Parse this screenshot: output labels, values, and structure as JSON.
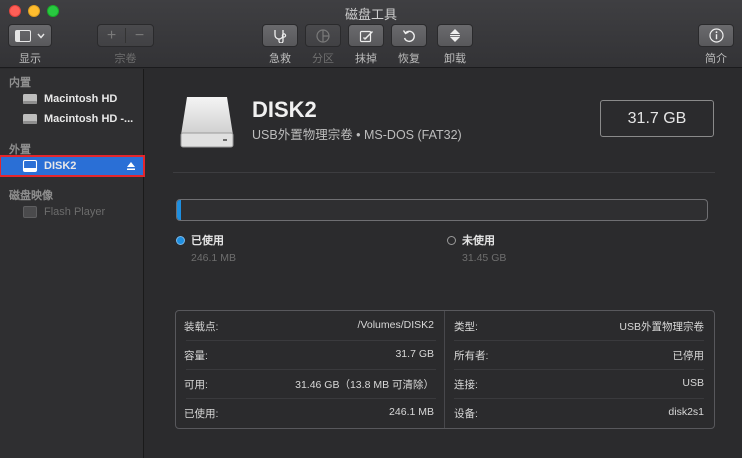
{
  "window": {
    "title": "磁盘工具"
  },
  "toolbar": {
    "view_label": "显示",
    "volume_label": "宗卷",
    "first_aid_label": "急救",
    "partition_label": "分区",
    "erase_label": "抹掉",
    "restore_label": "恢复",
    "unmount_label": "卸载",
    "info_label": "简介"
  },
  "sidebar": {
    "internal_header": "内置",
    "internal_items": [
      "Macintosh HD",
      "Macintosh HD -..."
    ],
    "external_header": "外置",
    "external_items": [
      "DISK2"
    ],
    "images_header": "磁盘映像",
    "image_items": [
      "Flash Player"
    ]
  },
  "disk": {
    "name": "DISK2",
    "subtitle": "USB外置物理宗卷 • MS-DOS (FAT32)",
    "capacity": "31.7 GB"
  },
  "usage": {
    "used_fraction": 0.0078,
    "used_label": "已使用",
    "used_value": "246.1 MB",
    "free_label": "未使用",
    "free_value": "31.45 GB",
    "used_color": "#1e8fe0"
  },
  "info": {
    "left": [
      {
        "key": "装载点:",
        "value": "/Volumes/DISK2"
      },
      {
        "key": "容量:",
        "value": "31.7 GB"
      },
      {
        "key": "可用:",
        "value": "31.46 GB（13.8 MB 可清除）"
      },
      {
        "key": "已使用:",
        "value": "246.1 MB"
      }
    ],
    "right": [
      {
        "key": "类型:",
        "value": "USB外置物理宗卷"
      },
      {
        "key": "所有者:",
        "value": "已停用"
      },
      {
        "key": "连接:",
        "value": "USB"
      },
      {
        "key": "设备:",
        "value": "disk2s1"
      }
    ]
  }
}
